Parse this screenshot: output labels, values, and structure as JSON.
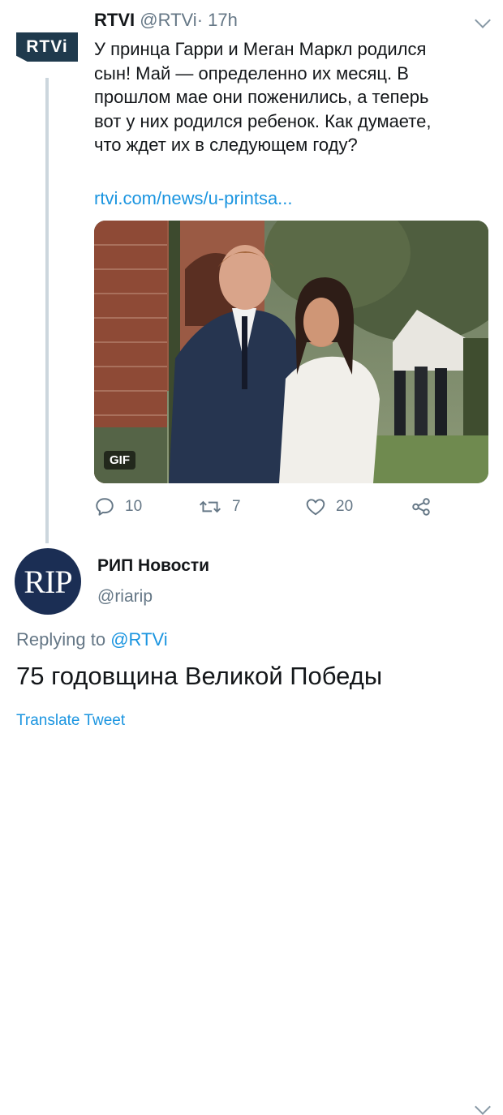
{
  "tweet": {
    "avatar_text": "RTVi",
    "name": "RTVI",
    "handle": "@RTVi",
    "separator": "·",
    "time": "17h",
    "text_lines": [
      "У принца Гарри и Меган Маркл родился",
      "сын! Май —  определенно их месяц. В",
      "прошлом мае они поженились, а теперь",
      "вот у них родился ребенок. Как думаете,",
      "что ждет их в следующем году?"
    ],
    "link": "rtvi.com/news/u-printsa...",
    "media_badge": "GIF",
    "actions": {
      "reply_count": "10",
      "retweet_count": "7",
      "like_count": "20"
    },
    "icons": [
      "reply-icon",
      "retweet-icon",
      "like-icon",
      "share-icon",
      "chevron-down-icon"
    ]
  },
  "reply": {
    "avatar_text": "RIP",
    "name": "РИП Новости",
    "handle": "@riarip",
    "replying_prefix": "Replying to ",
    "replying_mention": "@RTVi",
    "text": "75 годовщина Великой Победы",
    "translate": "Translate Tweet"
  },
  "colors": {
    "link": "#1b95e0",
    "secondary_text": "#657786",
    "primary_text": "#14171a",
    "thread_line": "#ccd6dd",
    "rtvi_brand": "#1f3a4d",
    "rip_brand": "#1b2e54"
  }
}
